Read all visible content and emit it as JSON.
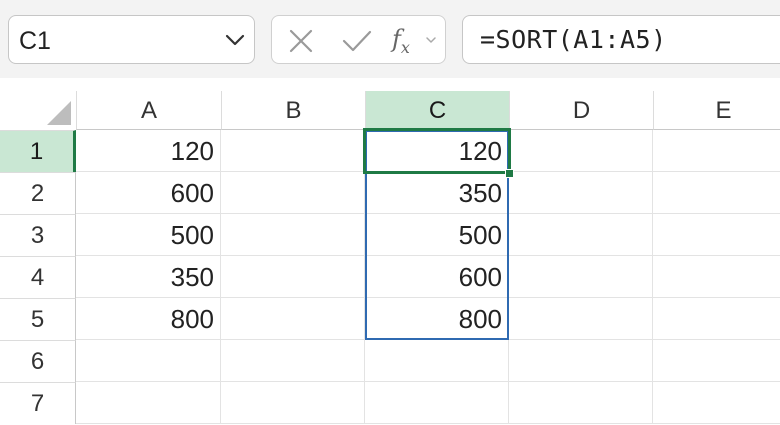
{
  "formula_bar": {
    "name_box": "C1",
    "formula": "=SORT(A1:A5)",
    "icons": {
      "name_box_dropdown": "chevron-down-icon",
      "cancel": "cancel-icon",
      "enter": "checkmark-icon",
      "insert_function": "function-icon",
      "fx_dropdown": "chevron-down-icon"
    }
  },
  "grid": {
    "columns": [
      "A",
      "B",
      "C",
      "D",
      "E"
    ],
    "selected_column": "C",
    "rows": [
      "1",
      "2",
      "3",
      "4",
      "5",
      "6",
      "7"
    ],
    "selected_row": "1",
    "cells": {
      "A1": "120",
      "A2": "600",
      "A3": "500",
      "A4": "350",
      "A5": "800",
      "C1": "120",
      "C2": "350",
      "C3": "500",
      "C4": "600",
      "C5": "800"
    },
    "active_cell": "C1",
    "spill_range": "C1:C5"
  },
  "colors": {
    "selection_green": "#1f7a45",
    "header_highlight": "#c9e7d3",
    "spill_blue": "#2f6ab1"
  }
}
